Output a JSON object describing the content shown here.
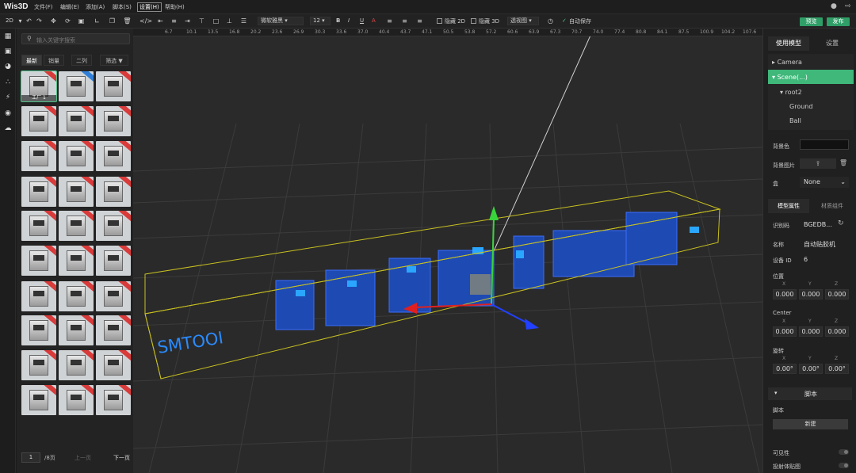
{
  "app": {
    "logo": "Wis3D"
  },
  "menus": [
    "文件(F)",
    "编辑(E)",
    "添加(A)",
    "脚本(S)",
    "设置(H)",
    "帮助(H)"
  ],
  "toolbar": {
    "mode": "2D",
    "font": "微软雅黑",
    "font_size": "12",
    "bold": "B",
    "italic": "I",
    "underline": "U",
    "font_color": "A",
    "hide2d": "隐藏 2D",
    "hide3d": "隐藏 3D",
    "view": "透视图",
    "autosave": "自动保存",
    "preview": "预览",
    "publish": "发布"
  },
  "ruler": [
    "6.7",
    "10.1",
    "13.5",
    "16.8",
    "20.2",
    "23.6",
    "26.9",
    "30.3",
    "33.6",
    "37.0",
    "40.4",
    "43.7",
    "47.1",
    "50.5",
    "53.8",
    "57.2",
    "60.6",
    "63.9",
    "67.3",
    "70.7",
    "74.0",
    "77.4",
    "80.8",
    "84.1",
    "87.5",
    "100.9",
    "104.2",
    "107.6",
    "110.9"
  ],
  "library": {
    "search_placeholder": "输入关键字搜索",
    "tabs": [
      "最新",
      "销量",
      "二列",
      "筛选"
    ],
    "first_caption": "工厂 1",
    "page": "1",
    "total": "/8页",
    "prev": "上一页",
    "next": "下一页"
  },
  "scene": {
    "floor_text": "SMTOOI"
  },
  "panel": {
    "tabs": [
      "使用模型",
      "设置"
    ],
    "tree": [
      "Camera",
      "Scene(...)",
      "root2",
      "Ground",
      "Ball"
    ],
    "bg_color_label": "背景色",
    "bg_image_label": "背景图片",
    "sky_label": "盒",
    "sky_value": "None",
    "sub_tabs": [
      "模型属性",
      "材质组件"
    ],
    "id_label": "识别码",
    "id_value": "BGEDB...",
    "name_label": "名称",
    "name_value": "自动贴胶机",
    "device_label": "设备 ID",
    "device_value": "6",
    "position_label": "位置",
    "center_label": "Center",
    "rotation_label": "旋转",
    "axes": [
      "X",
      "Y",
      "Z"
    ],
    "position": [
      "0.000",
      "0.000",
      "0.000"
    ],
    "center": [
      "0.000",
      "0.000",
      "0.000"
    ],
    "rotation": [
      "0.00°",
      "0.00°",
      "0.00°"
    ],
    "script_header": "脚本",
    "script_label": "脚本",
    "new_button": "新建",
    "visible_label": "可见性",
    "shadow_label": "投射体贴图"
  }
}
